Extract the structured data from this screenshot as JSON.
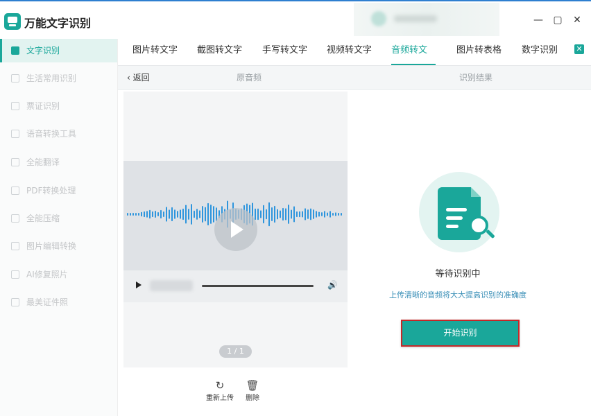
{
  "app": {
    "title": "万能文字识别"
  },
  "window": {
    "minimize": "—",
    "maximize": "▢",
    "close": "✕"
  },
  "sidebar": {
    "items": [
      {
        "label": "文字识别",
        "active": true
      },
      {
        "label": "生活常用识别"
      },
      {
        "label": "票证识别"
      },
      {
        "label": "语音转换工具"
      },
      {
        "label": "全能翻译"
      },
      {
        "label": "PDF转换处理"
      },
      {
        "label": "全能压缩"
      },
      {
        "label": "图片编辑转换"
      },
      {
        "label": "AI修复照片"
      },
      {
        "label": "最美证件照"
      }
    ]
  },
  "tabs": [
    {
      "label": "图片转文字"
    },
    {
      "label": "截图转文字"
    },
    {
      "label": "手写转文字"
    },
    {
      "label": "视频转文字"
    },
    {
      "label": "音频转文字",
      "active": true
    },
    {
      "label": "图片转表格"
    },
    {
      "label": "数字识别"
    }
  ],
  "subheader": {
    "back": "返回",
    "original_label": "原音频",
    "result_label": "识别结果"
  },
  "player": {
    "pager": "1 / 1"
  },
  "actions": {
    "reupload": "重新上传",
    "delete": "删除"
  },
  "result": {
    "status": "等待识别中",
    "hint": "上传清晰的音频将大大提高识别的准确度",
    "start_button": "开始识别"
  },
  "colors": {
    "accent": "#1aa79a",
    "highlight_border": "#c62828",
    "hint": "#3a8fb7"
  }
}
